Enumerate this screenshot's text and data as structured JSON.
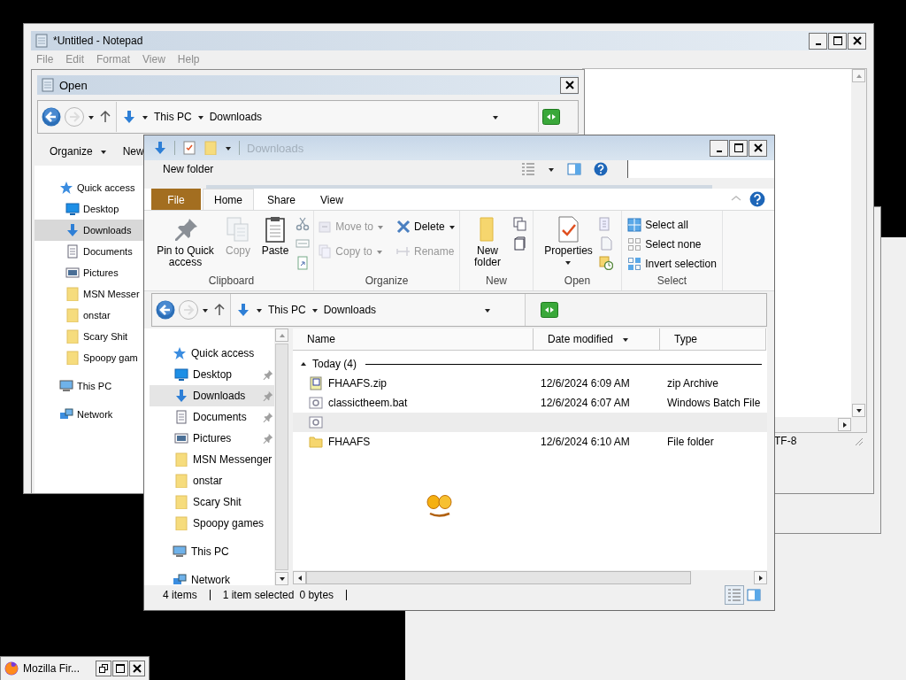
{
  "notepad": {
    "title": "*Untitled - Notepad",
    "menu": [
      "File",
      "Edit",
      "Format",
      "View",
      "Help"
    ],
    "status": "TF-8"
  },
  "open_dialog": {
    "title": "Open",
    "path": [
      "This PC",
      "Downloads"
    ],
    "toolbar": [
      {
        "label": "Organize",
        "has_menu": true
      },
      {
        "label": "New",
        "has_menu": false
      }
    ],
    "nav": [
      {
        "label": "Quick access",
        "kind": "quick-access",
        "selected": false,
        "children": [
          {
            "label": "Desktop",
            "kind": "desktop",
            "selected": false
          },
          {
            "label": "Downloads",
            "kind": "downloads",
            "selected": true
          },
          {
            "label": "Documents",
            "kind": "documents",
            "selected": false
          },
          {
            "label": "Pictures",
            "kind": "pictures",
            "selected": false
          },
          {
            "label": "MSN Messer",
            "kind": "folder",
            "selected": false
          },
          {
            "label": "onstar",
            "kind": "folder",
            "selected": false
          },
          {
            "label": "Scary Shit",
            "kind": "folder",
            "selected": false
          },
          {
            "label": "Spoopy gam",
            "kind": "folder",
            "selected": false
          }
        ]
      },
      {
        "label": "This PC",
        "kind": "this-pc",
        "selected": false
      },
      {
        "label": "Network",
        "kind": "network",
        "selected": false
      }
    ]
  },
  "explorer": {
    "title": "Downloads",
    "ghost_toolbar": "New folder",
    "tabs": [
      {
        "label": "File",
        "kind": "file",
        "selected": false
      },
      {
        "label": "Home",
        "kind": "tab",
        "selected": true
      },
      {
        "label": "Share",
        "kind": "tab",
        "selected": false
      },
      {
        "label": "View",
        "kind": "tab",
        "selected": false
      }
    ],
    "ribbon": [
      {
        "label": "Clipboard",
        "items": [
          {
            "label": "Pin to Quick access",
            "kind": "large",
            "disabled": false
          },
          {
            "label": "Copy",
            "kind": "large",
            "disabled": true
          },
          {
            "label": "Paste",
            "kind": "large",
            "disabled": false
          }
        ]
      },
      {
        "label": "Organize",
        "items": [
          {
            "label": "Move to",
            "kind": "small-menu",
            "disabled": true
          },
          {
            "label": "Copy to",
            "kind": "small-menu",
            "disabled": true
          },
          {
            "label": "Delete",
            "kind": "small-menu",
            "disabled": false
          },
          {
            "label": "Rename",
            "kind": "small",
            "disabled": true
          }
        ]
      },
      {
        "label": "New",
        "items": [
          {
            "label": "New folder",
            "kind": "large",
            "disabled": false
          }
        ]
      },
      {
        "label": "Open",
        "items": [
          {
            "label": "Properties",
            "kind": "large-menu",
            "disabled": false
          }
        ]
      },
      {
        "label": "Select",
        "items": [
          {
            "label": "Select all",
            "kind": "small",
            "disabled": false
          },
          {
            "label": "Select none",
            "kind": "small",
            "disabled": false
          },
          {
            "label": "Invert selection",
            "kind": "small",
            "disabled": false
          }
        ]
      }
    ],
    "path": [
      "This PC",
      "Downloads"
    ],
    "nav": [
      {
        "label": "Quick access",
        "kind": "quick-access",
        "selected": false,
        "children": [
          {
            "label": "Desktop",
            "kind": "desktop",
            "selected": false,
            "pinned": true
          },
          {
            "label": "Downloads",
            "kind": "downloads",
            "selected": true,
            "pinned": true
          },
          {
            "label": "Documents",
            "kind": "documents",
            "selected": false,
            "pinned": true
          },
          {
            "label": "Pictures",
            "kind": "pictures",
            "selected": false,
            "pinned": true
          },
          {
            "label": "MSN Messenger",
            "kind": "folder",
            "selected": false,
            "pinned": false
          },
          {
            "label": "onstar",
            "kind": "folder",
            "selected": false,
            "pinned": false
          },
          {
            "label": "Scary Shit",
            "kind": "folder",
            "selected": false,
            "pinned": false
          },
          {
            "label": "Spoopy games",
            "kind": "folder",
            "selected": false,
            "pinned": false
          }
        ]
      },
      {
        "label": "This PC",
        "kind": "this-pc",
        "selected": false
      },
      {
        "label": "Network",
        "kind": "network",
        "selected": false
      }
    ],
    "columns": [
      {
        "label": "Name",
        "sorted": false
      },
      {
        "label": "Date modified",
        "sorted": true
      },
      {
        "label": "Type",
        "sorted": false
      }
    ],
    "group": {
      "label": "Today (4)",
      "expanded": true
    },
    "rows": [
      {
        "name": "FHAAFS.zip",
        "date": "12/6/2024 6:09 AM",
        "type": "zip Archive",
        "kind": "zip",
        "selected": false
      },
      {
        "name": "classictheem.bat",
        "date": "12/6/2024 6:07 AM",
        "type": "Windows Batch File",
        "kind": "bat",
        "selected": false
      },
      {
        "kind": "bat",
        "selected": true
      },
      {
        "name": "FHAAFS",
        "date": "12/6/2024 6:10 AM",
        "type": "File folder",
        "kind": "folder",
        "selected": false
      }
    ],
    "status": [
      "4 items",
      "1 item selected",
      "0 bytes"
    ]
  },
  "taskbar_button": {
    "label": "Mozilla Fir..."
  }
}
